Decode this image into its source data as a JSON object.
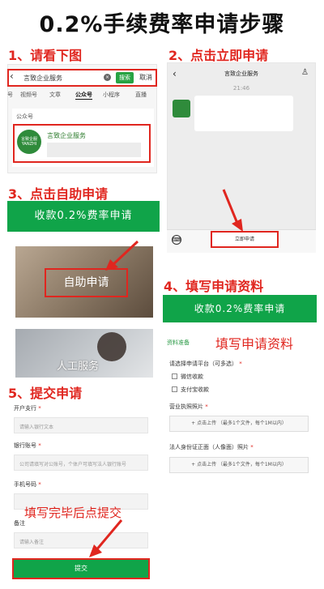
{
  "title": "0.2%手续费率申请步骤",
  "steps": {
    "s1": "1、请看下图",
    "s2": "2、点击立即申请",
    "s3": "3、点击自助申请",
    "s4": "4、填写申请资料",
    "s5": "5、提交申请"
  },
  "panel1": {
    "search_value": "言致企业服务",
    "search_button": "搜索",
    "cancel": "取消",
    "tabs": [
      "号",
      "视频号",
      "文章",
      "公众号",
      "小程序",
      "直播"
    ],
    "active_tab": "公众号",
    "section_header": "公众号",
    "result_name": "言致企业服务",
    "logo_text": "言致企服 YANZHI"
  },
  "panel2": {
    "title": "言致企业服务",
    "time": "21:46",
    "apply_button": "立即申请"
  },
  "panel3": {
    "banner": "收款0.2%费率申请",
    "self_service": "自助申请",
    "human_service": "人工服务"
  },
  "panel4": {
    "banner": "收款0.2%费率申请",
    "section": "资料准备",
    "overlay_text": "填写申请资料",
    "platform_label": "请选择申请平台（可多选）",
    "options": [
      "微信收款",
      "支付宝收款"
    ],
    "license_label": "营业执照照片",
    "id_label": "法人身份证正面（人像面）照片",
    "upload_text": "+ 点击上传 （最多1个文件，每个1M以内）"
  },
  "panel5": {
    "bank_label": "开户支行",
    "bank_placeholder": "请输入银行文本",
    "account_label": "银行账号",
    "account_placeholder": "公司请填写对公账号，个体户可填写法人银行账号",
    "phone_label": "手机号码",
    "remark_label": "备注",
    "remark_placeholder": "请输入备注",
    "overlay_note": "填写完毕后点提交",
    "submit": "提交"
  },
  "colors": {
    "accent_red": "#e0261f",
    "brand_green": "#10a449"
  }
}
